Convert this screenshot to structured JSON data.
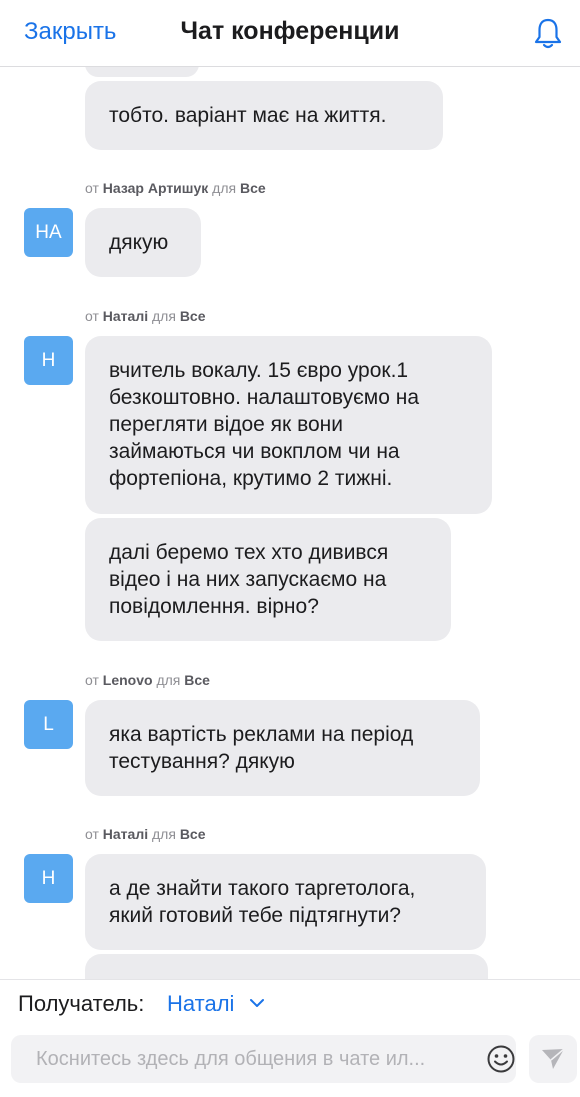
{
  "header": {
    "close_label": "Закрыть",
    "title": "Чат конференции"
  },
  "messages": [
    {
      "text": "тобто. варіант має на життя."
    },
    {
      "meta": {
        "from_word": "от",
        "sender": "Назар Артишук",
        "to_word": "для",
        "recipient": "Все"
      },
      "avatar": "НА",
      "text": "дякую"
    },
    {
      "meta": {
        "from_word": "от",
        "sender": "Наталі",
        "to_word": "для",
        "recipient": "Все"
      },
      "avatar": "Н",
      "text": "вчитель вокалу. 15 євро урок.1\nбезкоштовно.  налаштовуємо на\nперегляти відое як вони\nзаймаються чи вокплом чи на\nфортепіона, крутимо 2 тижні."
    },
    {
      "text": "далі беремо тех хто дивився\nвідео і на них запускаємо на\nповідомлення. вірно?"
    },
    {
      "meta": {
        "from_word": "от",
        "sender": "Lenovo",
        "to_word": "для",
        "recipient": "Все"
      },
      "avatar": "L",
      "text": "яка вартість реклами на період\nтестування? дякую"
    },
    {
      "meta": {
        "from_word": "от",
        "sender": "Наталі",
        "to_word": "для",
        "recipient": "Все"
      },
      "avatar": "Н",
      "text": "а де знайти такого таргетолога,\nякий готовий тебе підтягнути?"
    }
  ],
  "recipient": {
    "label": "Получатель:",
    "value": "Наталі"
  },
  "input": {
    "placeholder": "Коснитесь здесь для общения в чате ил..."
  },
  "colors": {
    "accent": "#1a73e8",
    "avatar": "#5aa9f0",
    "bubble": "#ebebee"
  },
  "icons": {
    "bell": "bell-icon",
    "chevron": "chevron-down-icon",
    "emoji": "smiley-icon",
    "send": "send-icon"
  }
}
